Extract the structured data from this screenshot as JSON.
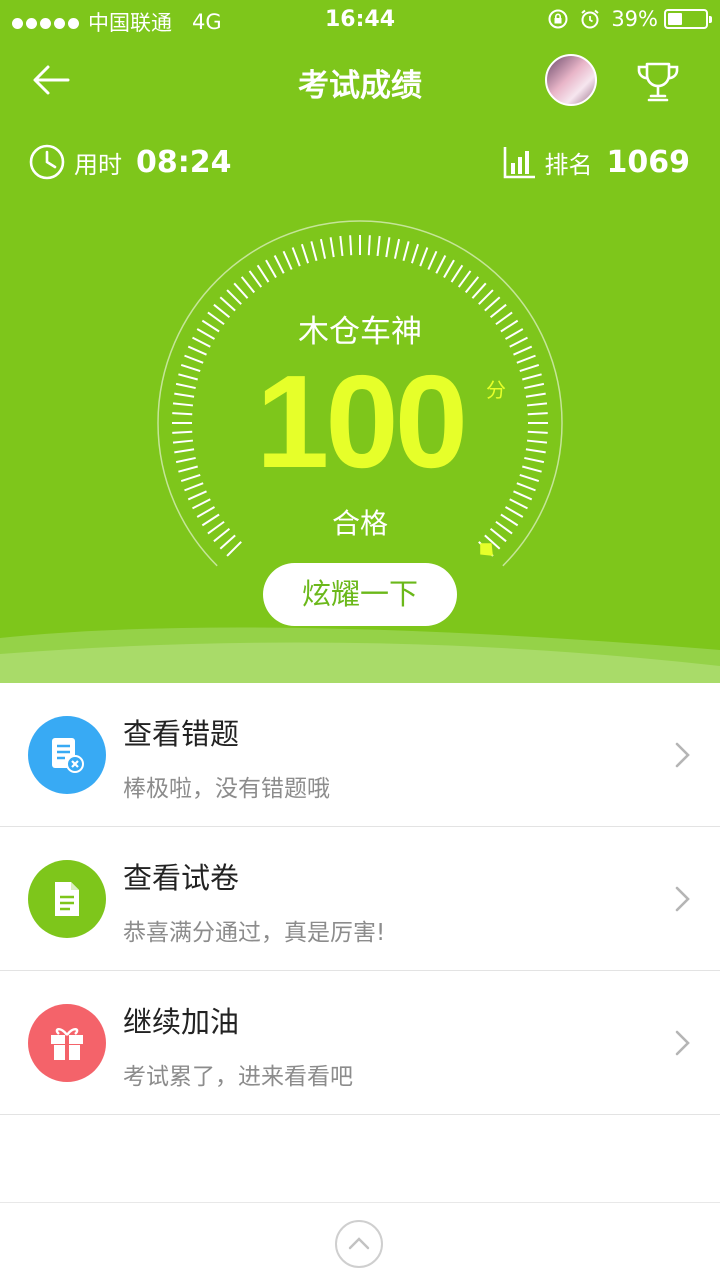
{
  "status_bar": {
    "carrier": "中国联通",
    "network": "4G",
    "time": "16:44",
    "battery_text": "39%",
    "battery_level": 0.39
  },
  "nav": {
    "title": "考试成绩",
    "back_icon": "arrow-left-icon",
    "trophy_icon": "trophy-icon"
  },
  "stats": {
    "time_label": "用时",
    "time_value": "08:24",
    "rank_label": "排名",
    "rank_value": "1069"
  },
  "result": {
    "title_name": "木仓车神",
    "score": "100",
    "unit": "分",
    "status": "合格",
    "gauge_fraction": 1.0
  },
  "share_button": "炫耀一下",
  "items": [
    {
      "title": "查看错题",
      "subtitle": "棒极啦，没有错题哦",
      "icon": "wrong-questions-icon",
      "color": "#38aaf4"
    },
    {
      "title": "查看试卷",
      "subtitle": "恭喜满分通过，真是厉害!",
      "icon": "exam-paper-icon",
      "color": "#7ec61b"
    },
    {
      "title": "继续加油",
      "subtitle": "考试累了，进来看看吧",
      "icon": "gift-icon",
      "color": "#f4636a"
    }
  ],
  "colors": {
    "header_green": "#7ec61b",
    "score_yellow": "#e6ff2a"
  }
}
